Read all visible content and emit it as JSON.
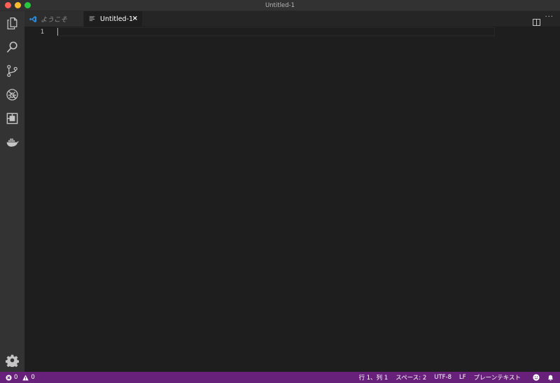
{
  "window": {
    "title": "Untitled-1",
    "controls": [
      "close",
      "minimize",
      "zoom"
    ]
  },
  "activity_bar": {
    "items": [
      {
        "icon": "files-icon"
      },
      {
        "icon": "search-icon"
      },
      {
        "icon": "source-control-icon"
      },
      {
        "icon": "debug-icon"
      },
      {
        "icon": "extensions-icon"
      },
      {
        "icon": "docker-icon"
      }
    ],
    "bottom": {
      "icon": "gear-icon"
    }
  },
  "tabs": [
    {
      "label": "ようこそ",
      "icon": "vscode-logo-icon",
      "active": false
    },
    {
      "label": "Untitled-1",
      "icon": "file-lines-icon",
      "active": true,
      "close": "×"
    }
  ],
  "editor": {
    "line_numbers": [
      "1"
    ],
    "content": ""
  },
  "status_bar": {
    "errors": "0",
    "warnings": "0",
    "position": "行 1、列 1",
    "indent": "スペース: 2",
    "encoding": "UTF-8",
    "eol": "LF",
    "language": "プレーンテキスト"
  },
  "colors": {
    "status_bar": "#68217a",
    "editor_bg": "#1e1e1e",
    "activity_bar": "#333333",
    "tab_bar": "#252526"
  }
}
